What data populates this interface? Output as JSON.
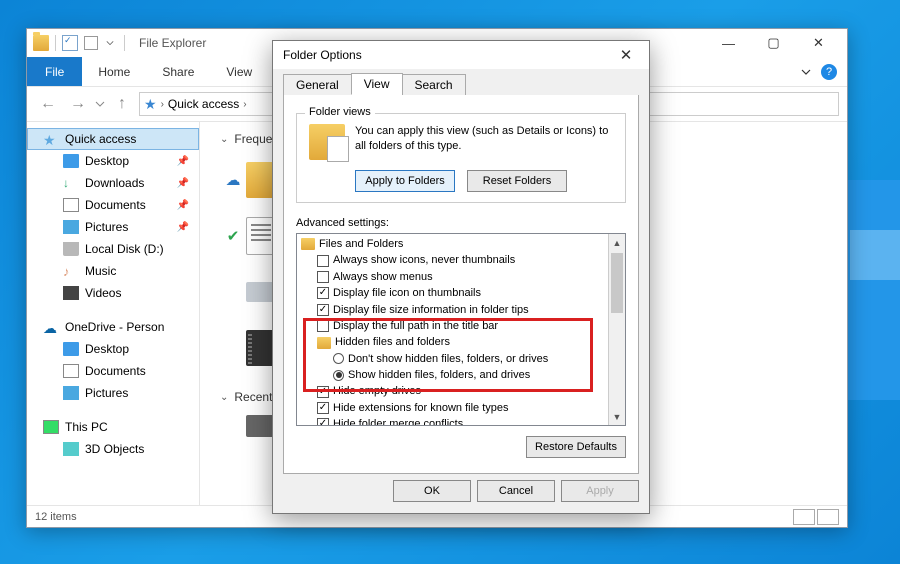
{
  "explorer": {
    "title": "File Explorer",
    "win_min": "—",
    "win_max": "▢",
    "win_close": "✕",
    "tabs": {
      "file": "File",
      "home": "Home",
      "share": "Share",
      "view": "View"
    },
    "nav_back": "←",
    "nav_fwd": "→",
    "nav_up": "↑",
    "crumb_chev": "›",
    "crumb_text": "Quick access",
    "dropdown_chev": "⌄",
    "sidebar": {
      "quick": "Quick access",
      "desktop": "Desktop",
      "downloads": "Downloads",
      "documents": "Documents",
      "pictures": "Pictures",
      "localdisk": "Local Disk (D:)",
      "music": "Music",
      "videos": "Videos",
      "onedrive": "OneDrive - Person",
      "od_desktop": "Desktop",
      "od_documents": "Documents",
      "od_pictures": "Pictures",
      "thispc": "This PC",
      "threed": "3D Objects",
      "pin": "📌"
    },
    "sections": {
      "frequent": "Freque",
      "recent": "Recent"
    },
    "status": "12 items"
  },
  "dialog": {
    "title": "Folder Options",
    "close": "✕",
    "tabs": {
      "general": "General",
      "view": "View",
      "search": "Search"
    },
    "folder_views": {
      "legend": "Folder views",
      "text1": "You can apply this view (such as Details or Icons) to",
      "text2": "all folders of this type.",
      "apply": "Apply to Folders",
      "reset": "Reset Folders"
    },
    "advanced": {
      "label": "Advanced settings:",
      "root": "Files and Folders",
      "items": [
        {
          "type": "check",
          "checked": false,
          "label": "Always show icons, never thumbnails"
        },
        {
          "type": "check",
          "checked": false,
          "label": "Always show menus"
        },
        {
          "type": "check",
          "checked": true,
          "label": "Display file icon on thumbnails"
        },
        {
          "type": "check",
          "checked": true,
          "label": "Display file size information in folder tips"
        },
        {
          "type": "check",
          "checked": false,
          "label": "Display the full path in the title bar"
        },
        {
          "type": "folder",
          "label": "Hidden files and folders"
        },
        {
          "type": "radio",
          "checked": false,
          "label": "Don't show hidden files, folders, or drives"
        },
        {
          "type": "radio",
          "checked": true,
          "label": "Show hidden files, folders, and drives"
        },
        {
          "type": "check",
          "checked": true,
          "label": "Hide empty drives"
        },
        {
          "type": "check",
          "checked": true,
          "label": "Hide extensions for known file types"
        },
        {
          "type": "check",
          "checked": true,
          "label": "Hide folder merge conflicts"
        }
      ],
      "scroll_up": "▲",
      "scroll_dn": "▼"
    },
    "restore": "Restore Defaults",
    "ok": "OK",
    "cancel": "Cancel",
    "apply": "Apply"
  }
}
